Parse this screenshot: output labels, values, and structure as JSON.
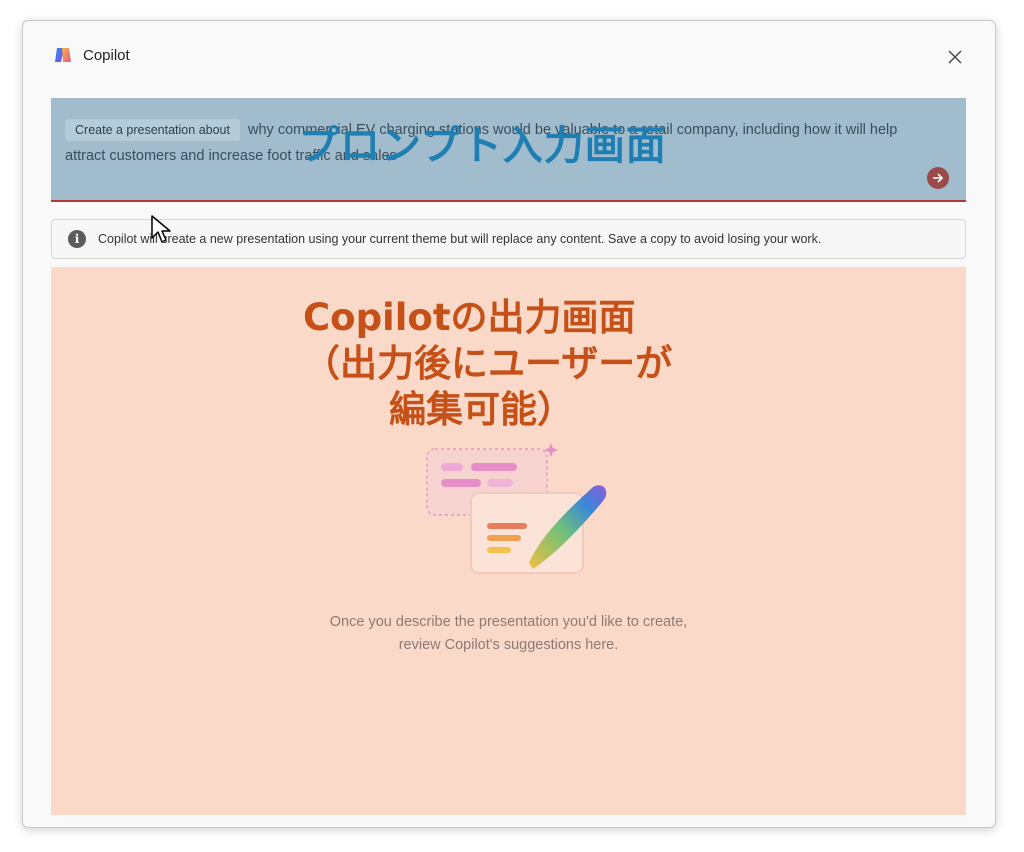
{
  "window": {
    "title": "Copilot",
    "logo_icon": "copilot-logo-icon",
    "close_icon": "close-icon"
  },
  "prompt": {
    "chip_label": "Create a presentation about",
    "text": "why commercial EV charging stations would be valuable to a retail company, including how it will help attract customers and increase foot traffic and sales",
    "submit_icon": "arrow-right-icon",
    "annotation": "プロンプト入力画面"
  },
  "notice": {
    "icon": "info-icon",
    "text": "Copilot will create a new presentation using your current theme but will replace any content. Save a copy to avoid losing your work."
  },
  "output": {
    "annotation_line1": "Copilotの出力画面",
    "annotation_line2": "（出力後にユーザーが",
    "annotation_line3": "編集可能）",
    "empty_line1": "Once you describe the presentation you'd like to create,",
    "empty_line2": "review Copilot's suggestions here.",
    "illustration_icon": "presentation-pen-illustration"
  },
  "colors": {
    "prompt_overlay": "#a0bccd",
    "output_overlay": "#fbd9c9",
    "prompt_annotation": "#1f7fb2",
    "output_annotation": "#c55018",
    "submit_button": "#9a4a48"
  }
}
